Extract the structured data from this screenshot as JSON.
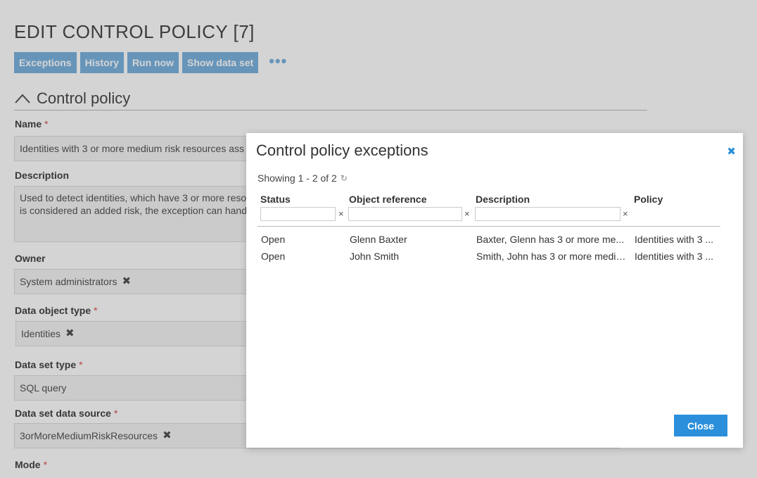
{
  "page": {
    "title": "EDIT CONTROL POLICY [7]",
    "toolbar": {
      "exceptions": "Exceptions",
      "history": "History",
      "run_now": "Run now",
      "show_data_set": "Show data set",
      "more": "•••"
    },
    "section_title": "Control policy",
    "fields": {
      "name": {
        "label": "Name",
        "required": "*",
        "value": "Identities with 3 or more medium risk resources ass"
      },
      "description": {
        "label": "Description",
        "value_line1": "Used to detect identities, which have 3 or more reso",
        "value_line2": "is considered an added risk, the exception can hand"
      },
      "owner": {
        "label": "Owner",
        "value": "System administrators"
      },
      "data_object_type": {
        "label": "Data object type",
        "required": "*",
        "value": "Identities"
      },
      "data_set_type": {
        "label": "Data set type",
        "required": "*",
        "value": "SQL query"
      },
      "data_set_data_source": {
        "label": "Data set data source",
        "required": "*",
        "value": "3orMoreMediumRiskResources"
      },
      "mode": {
        "label": "Mode",
        "required": "*"
      }
    },
    "chip_remove": "✖"
  },
  "modal": {
    "title": "Control policy exceptions",
    "close_x": "✖",
    "showing": "Showing 1 - 2 of 2",
    "refresh": "↻",
    "columns": [
      "Status",
      "Object reference",
      "Description",
      "Policy"
    ],
    "filter_clear": "×",
    "rows": [
      {
        "status": "Open",
        "object_reference": "Glenn Baxter",
        "description": "Baxter, Glenn has 3 or more me...",
        "policy": "Identities with 3 ..."
      },
      {
        "status": "Open",
        "object_reference": "John Smith",
        "description": "Smith, John has 3 or more mediu...",
        "policy": "Identities with 3 ..."
      }
    ],
    "close_button": "Close"
  }
}
